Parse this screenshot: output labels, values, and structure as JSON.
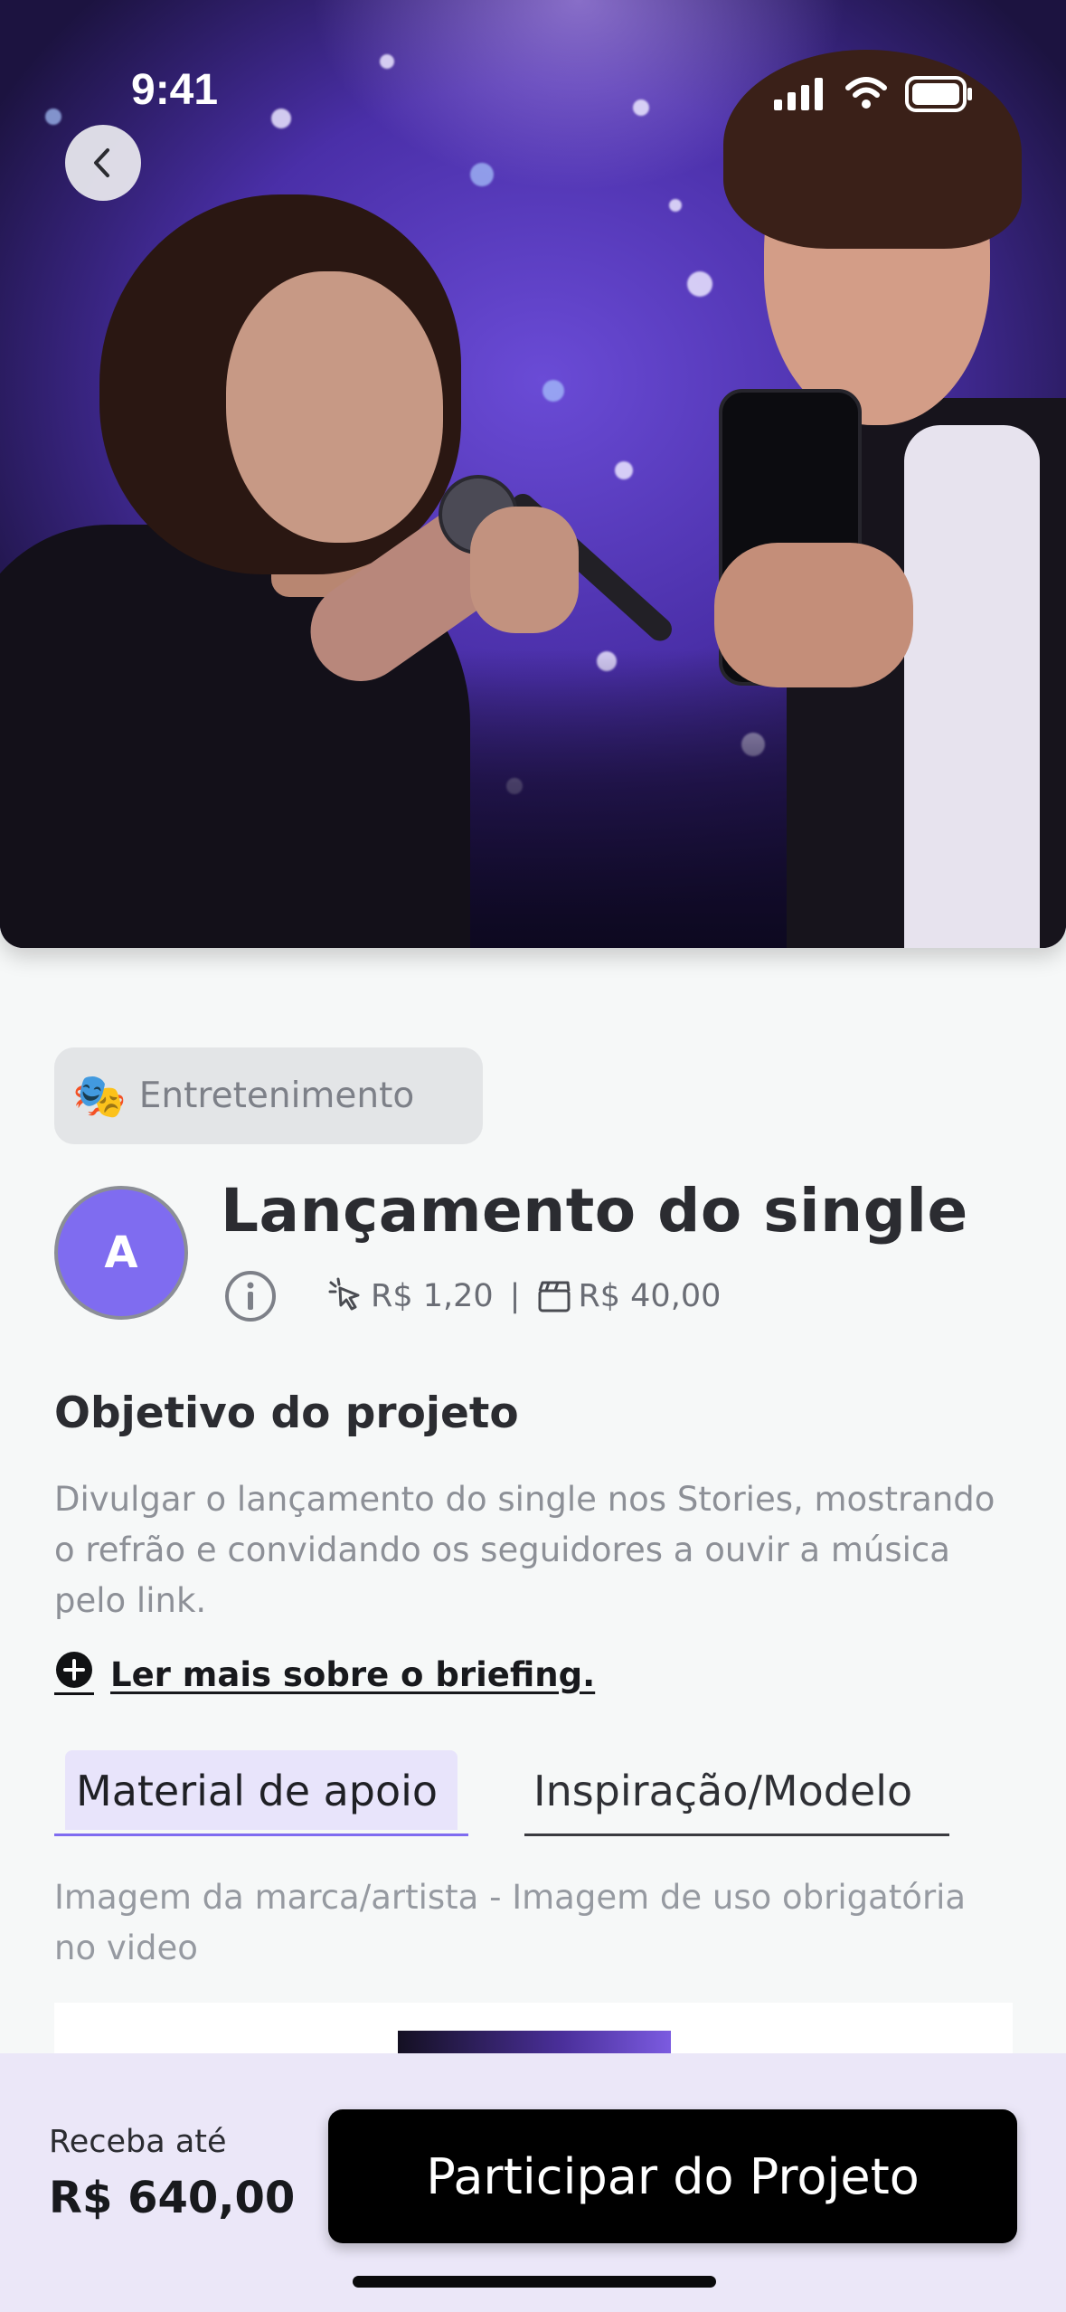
{
  "status_bar": {
    "time": "9:41"
  },
  "header": {
    "back_icon": "chevron-left-icon"
  },
  "category": {
    "emoji": "🎭",
    "label": "Entretenimento"
  },
  "project": {
    "avatar_initial": "A",
    "title": "Lançamento do single",
    "price_per_click": "R$ 1,20",
    "price_per_video": "R$ 40,00"
  },
  "objective": {
    "heading": "Objetivo do projeto",
    "text": "Divulgar o lançamento do single nos Stories, mostrando o refrão e convidando os seguidores a ouvir a música pelo link.",
    "briefing_link": "Ler mais sobre o briefing."
  },
  "tabs": [
    {
      "label": "Material de apoio",
      "active": true
    },
    {
      "label": "Inspiração/Modelo",
      "active": false
    }
  ],
  "support_material": {
    "description": "Imagem da marca/artista - Imagem de uso obrigatória no video"
  },
  "footer": {
    "earn_label": "Receba até",
    "earn_value": "R$ 640,00",
    "cta_label": "Participar do Projeto"
  },
  "colors": {
    "accent": "#7f6cf0",
    "cta": "#000000",
    "footer_bg": "#ebe7f8",
    "chip_bg": "#e3e5e7"
  }
}
